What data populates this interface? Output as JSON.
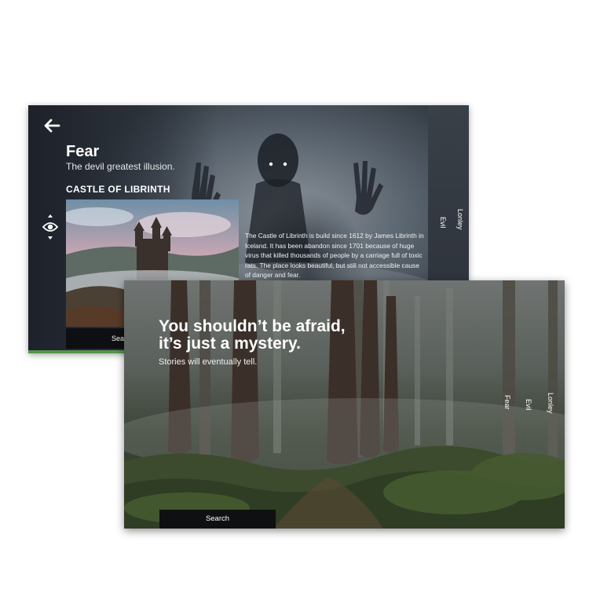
{
  "back_screen": {
    "title": "Fear",
    "subtitle": "The devil greatest illusion.",
    "section_title": "CASTLE OF LIBRINTH",
    "description": "The Castle of Librinth is build since 1612 by James Librinth in Iceland. It has been abandon since 1701 because of huge virus that killed thousands of people by a carriage full of toxic rats. The place looks beautiful, but still not accessible cause of danger and fear.",
    "tabs": [
      "Evil",
      "Lonley"
    ],
    "search_label": "Search",
    "accent_color": "#4f9a43",
    "icons": [
      "back-arrow-icon",
      "eye-icon"
    ]
  },
  "front_screen": {
    "headline_line1": "You shouldn’t be afraid,",
    "headline_line2": "it’s just a mystery.",
    "subtitle": "Stories will eventually tell.",
    "tabs": [
      "Fear",
      "Evil",
      "Lonley"
    ],
    "search_label": "Search"
  }
}
